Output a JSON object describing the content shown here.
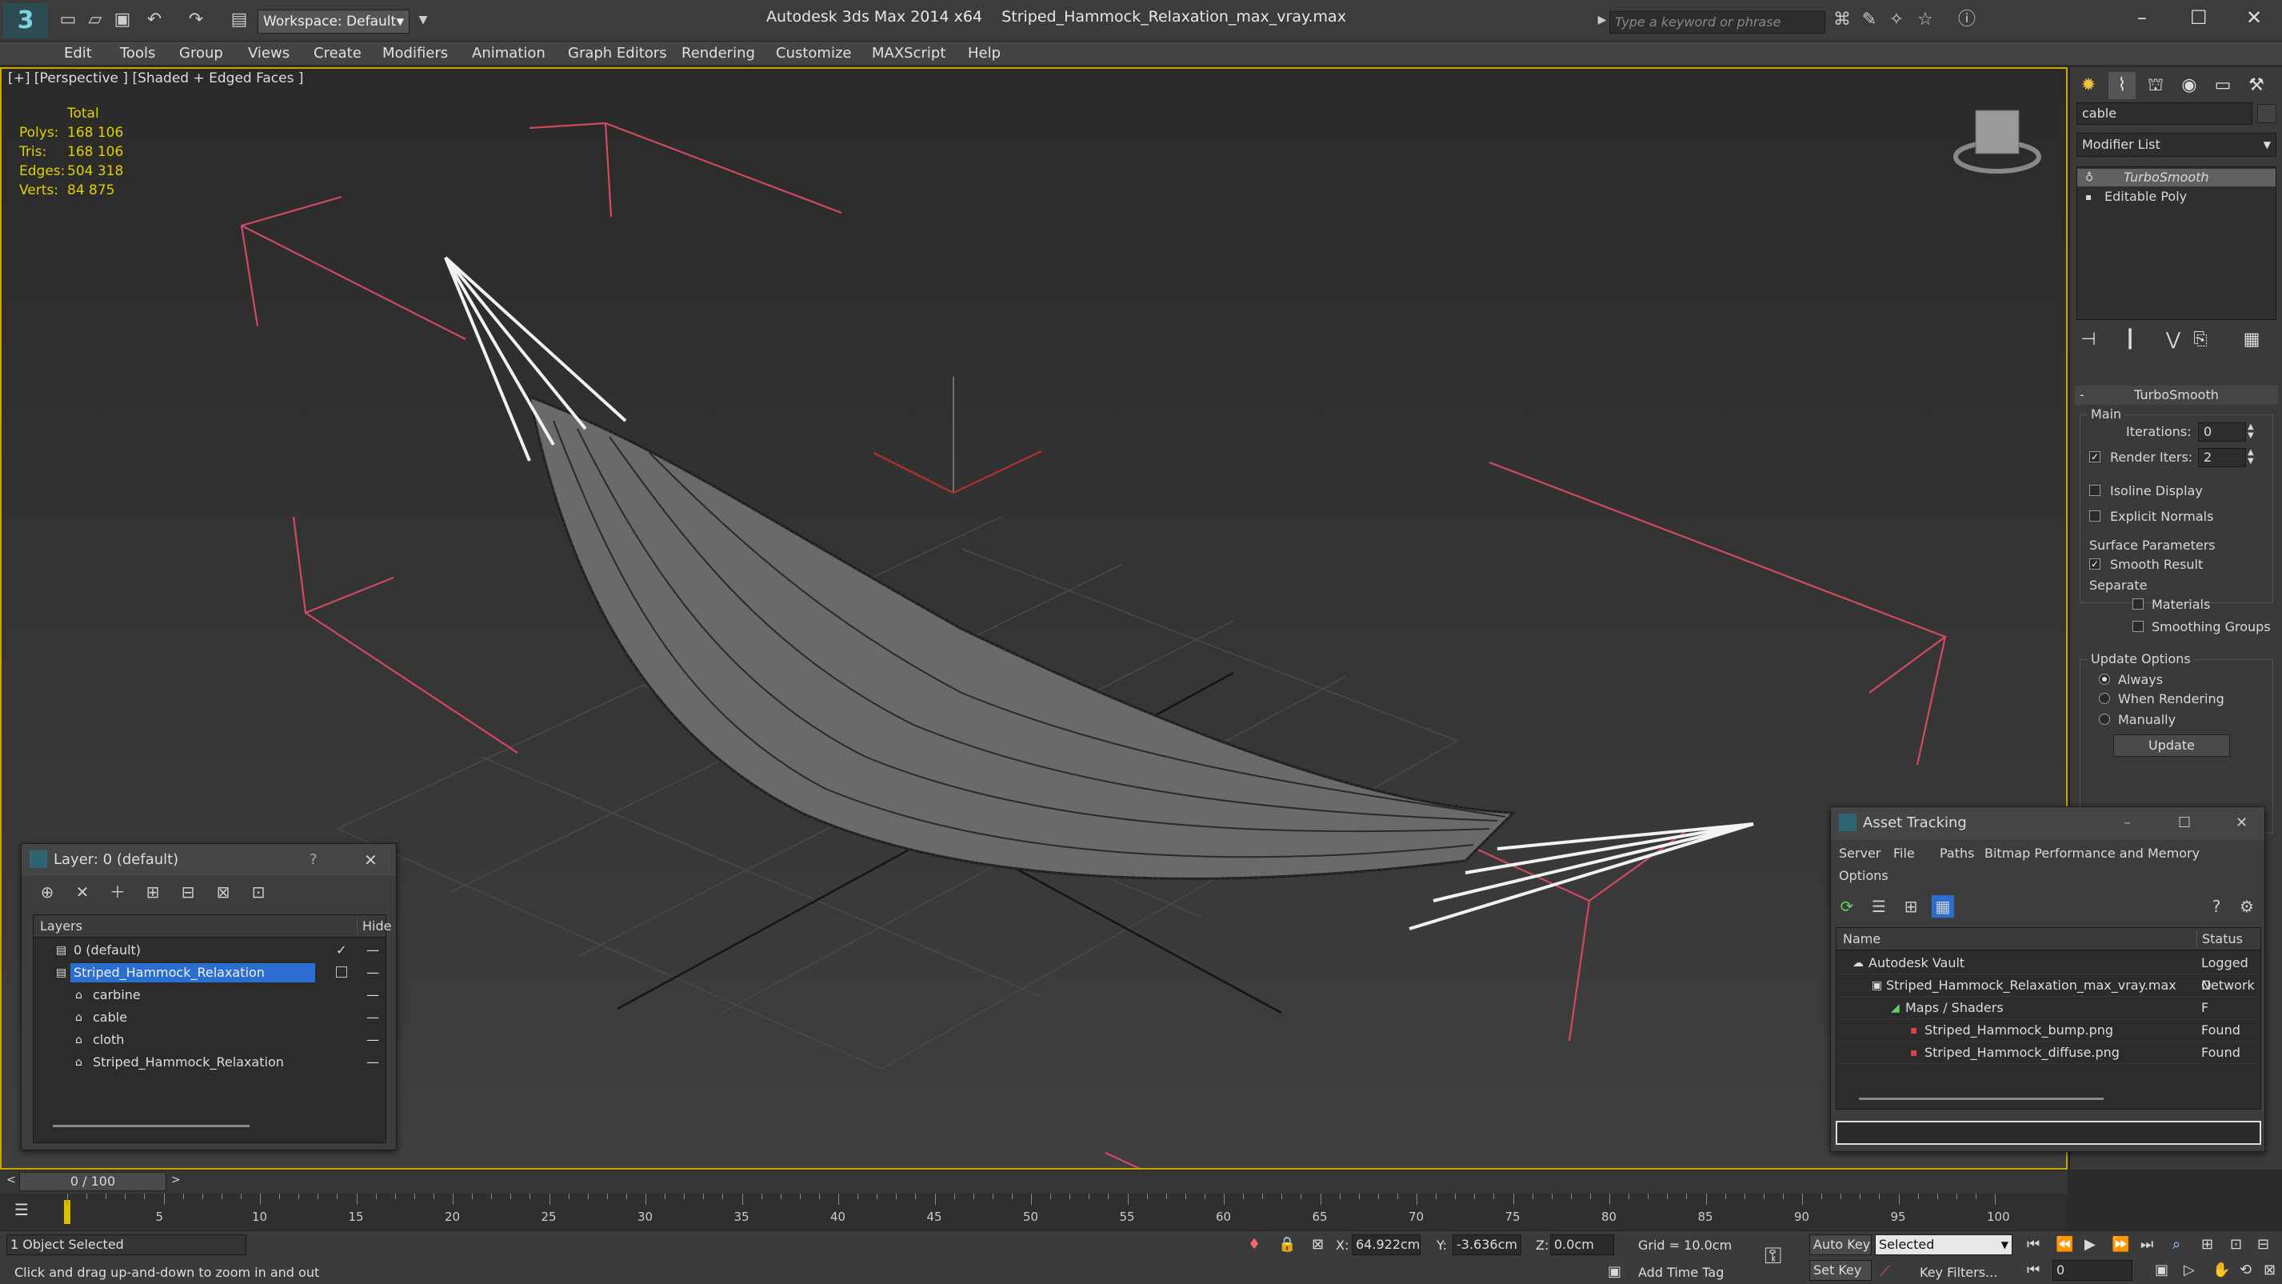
{
  "app": {
    "title": "Autodesk 3ds Max  2014 x64",
    "filename": "Striped_Hammock_Relaxation_max_vray.max",
    "workspace": "Workspace: Default",
    "search_placeholder": "Type a keyword or phrase"
  },
  "menu": [
    "Edit",
    "Tools",
    "Group",
    "Views",
    "Create",
    "Modifiers",
    "Animation",
    "Graph Editors",
    "Rendering",
    "Customize",
    "MAXScript",
    "Help"
  ],
  "viewport": {
    "label": "[+] [Perspective ] [Shaded + Edged Faces ]",
    "stats": {
      "header": "Total",
      "rows": [
        {
          "label": "Polys:",
          "value": "168 106"
        },
        {
          "label": "Tris:",
          "value": "168 106"
        },
        {
          "label": "Edges:",
          "value": "504 318"
        },
        {
          "label": "Verts:",
          "value": "84 875"
        }
      ]
    },
    "accent": "#c9a800"
  },
  "command_panel": {
    "object_name": "cable",
    "modifier_list": "Modifier List",
    "stack": [
      "TurboSmooth",
      "Editable Poly"
    ],
    "rollout_title": "TurboSmooth",
    "main_label": "Main",
    "iterations_label": "Iterations:",
    "iterations_value": "0",
    "render_iters_label": "Render Iters:",
    "render_iters_value": "2",
    "isoline_label": "Isoline Display",
    "explicit_normals_label": "Explicit Normals",
    "surface_params_label": "Surface Parameters",
    "smooth_result_label": "Smooth Result",
    "separate_label": "Separate",
    "materials_label": "Materials",
    "smoothing_groups_label": "Smoothing Groups",
    "update_options_label": "Update Options",
    "always_label": "Always",
    "when_rendering_label": "When Rendering",
    "manually_label": "Manually",
    "update_button": "Update"
  },
  "layer_window": {
    "title": "Layer: 0 (default)",
    "help": "?",
    "col_layers": "Layers",
    "col_hide": "Hide",
    "rows": [
      {
        "label": "0 (default)",
        "indent": 0
      },
      {
        "label": "Striped_Hammock_Relaxation",
        "indent": 0
      },
      {
        "label": "carbine",
        "indent": 1
      },
      {
        "label": "cable",
        "indent": 1
      },
      {
        "label": "cloth",
        "indent": 1
      },
      {
        "label": "Striped_Hammock_Relaxation",
        "indent": 1
      }
    ]
  },
  "asset_window": {
    "title": "Asset Tracking",
    "menu": [
      "Server",
      "File",
      "Paths",
      "Bitmap Performance and Memory",
      "Options"
    ],
    "col_name": "Name",
    "col_status": "Status",
    "rows": [
      {
        "name": "Autodesk Vault",
        "status": "Logged O",
        "indent": 0
      },
      {
        "name": "Striped_Hammock_Relaxation_max_vray.max",
        "status": "Network F",
        "indent": 1
      },
      {
        "name": "Maps / Shaders",
        "status": "",
        "indent": 2
      },
      {
        "name": "Striped_Hammock_bump.png",
        "status": "Found",
        "indent": 3
      },
      {
        "name": "Striped_Hammock_diffuse.png",
        "status": "Found",
        "indent": 3
      }
    ]
  },
  "timeline": {
    "frame_label": "0 / 100",
    "ticks": [
      "5",
      "10",
      "15",
      "20",
      "25",
      "30",
      "35",
      "40",
      "45",
      "50",
      "55",
      "60",
      "65",
      "70",
      "75",
      "80",
      "85",
      "90",
      "95",
      "100"
    ]
  },
  "status": {
    "selected_text": "1 Object Selected",
    "hint": "Click and drag up-and-down to zoom in and out",
    "x_label": "X:",
    "x_value": "64.922cm",
    "y_label": "Y:",
    "y_value": "-3.636cm",
    "z_label": "Z:",
    "z_value": "0.0cm",
    "grid": "Grid = 10.0cm",
    "add_time_tag": "Add Time Tag",
    "auto_key": "Auto Key",
    "set_key": "Set Key",
    "selected_dropdown": "Selected",
    "key_filters": "Key Filters...",
    "frame_field": "0"
  }
}
